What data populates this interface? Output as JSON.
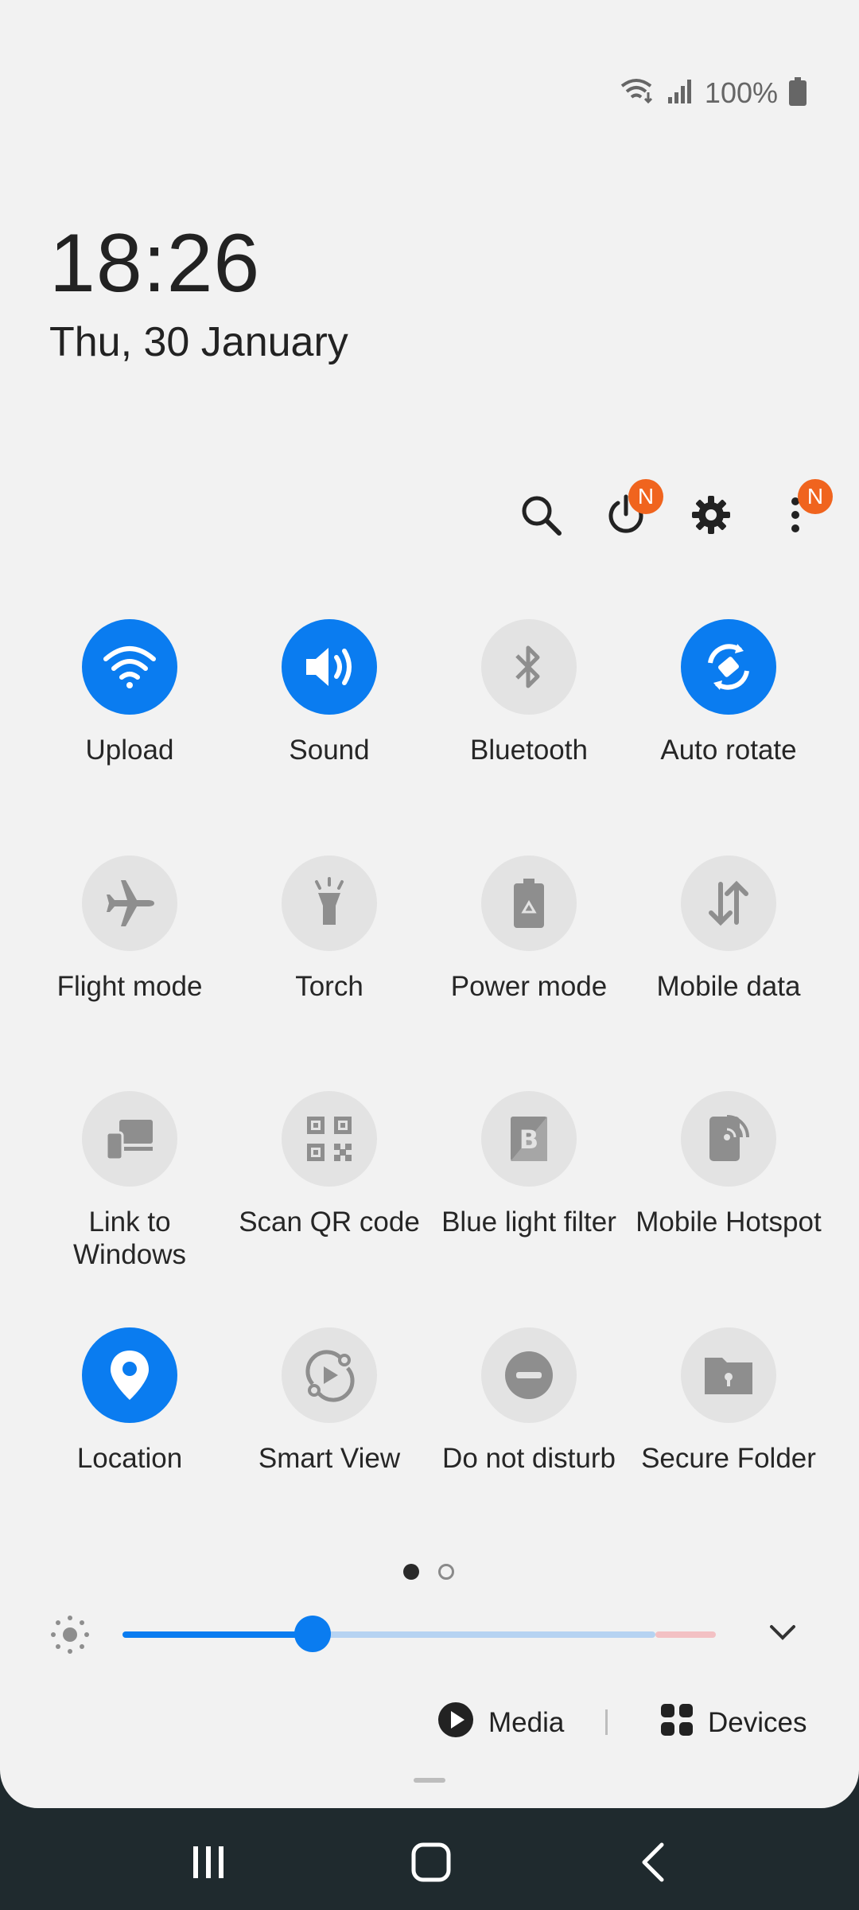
{
  "status": {
    "battery_percent": "100%"
  },
  "clock": {
    "time": "18:26",
    "date": "Thu, 30 January"
  },
  "toolbar": {
    "power_badge": "N",
    "more_badge": "N"
  },
  "tiles": [
    {
      "label": "Upload",
      "icon": "wifi-icon",
      "active": true
    },
    {
      "label": "Sound",
      "icon": "volume-icon",
      "active": true
    },
    {
      "label": "Bluetooth",
      "icon": "bluetooth-icon",
      "active": false
    },
    {
      "label": "Auto rotate",
      "icon": "auto-rotate-icon",
      "active": true
    },
    {
      "label": "Flight mode",
      "icon": "airplane-icon",
      "active": false
    },
    {
      "label": "Torch",
      "icon": "flashlight-icon",
      "active": false
    },
    {
      "label": "Power mode",
      "icon": "battery-recycle-icon",
      "active": false
    },
    {
      "label": "Mobile data",
      "icon": "data-arrows-icon",
      "active": false
    },
    {
      "label": "Link to Windows",
      "icon": "devices-link-icon",
      "active": false
    },
    {
      "label": "Scan QR code",
      "icon": "qr-code-icon",
      "active": false
    },
    {
      "label": "Blue light filter",
      "icon": "blue-light-b-icon",
      "active": false
    },
    {
      "label": "Mobile Hotspot",
      "icon": "hotspot-icon",
      "active": false
    },
    {
      "label": "Location",
      "icon": "location-pin-icon",
      "active": true
    },
    {
      "label": "Smart View",
      "icon": "smart-view-icon",
      "active": false
    },
    {
      "label": "Do not disturb",
      "icon": "minus-circle-icon",
      "active": false
    },
    {
      "label": "Secure Folder",
      "icon": "secure-folder-icon",
      "active": false
    }
  ],
  "pager": {
    "current_page": 1,
    "total_pages": 2
  },
  "brightness": {
    "level": 0.32
  },
  "bottom": {
    "media_label": "Media",
    "devices_label": "Devices"
  },
  "colors": {
    "accent": "#0a7cf0",
    "badge": "#f0641e",
    "tile_off": "#e3e3e3",
    "panel_bg": "#f2f2f2",
    "nav_bg": "#1f2a2e"
  }
}
